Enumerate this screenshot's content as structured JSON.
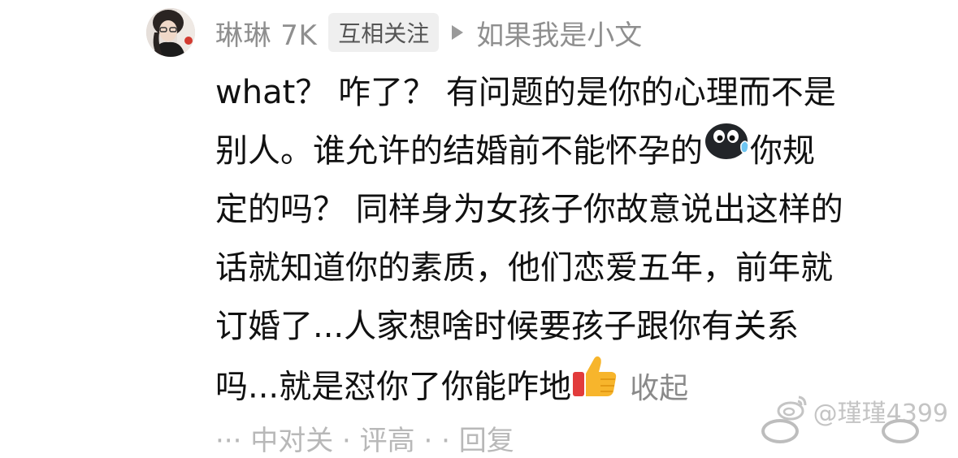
{
  "comment": {
    "author": {
      "name": "琳琳 7K",
      "relation_badge": "互相关注",
      "reply_to": "如果我是小文"
    },
    "body_lines": [
      "what？ 咋了？ 有问题的是你的心理而不是",
      "别人。谁允许的结婚前不能怀孕的",
      "你规",
      "定的吗？ 同样身为女孩子你故意说出这样的",
      "话就知道你的素质，他们恋爱五年，前年就",
      "订婚了...人家想啥时候要孩子跟你有关系",
      "吗...就是怼你了你能咋地"
    ],
    "emoji": {
      "sweat": "sweat-face-icon",
      "thumbs": "thumbs-up-icon"
    },
    "collapse_label": "收起",
    "footer_peek": "··· 中对关 · 评高 · · 回复",
    "watermark": "@瑾瑾4399"
  },
  "colors": {
    "meta_gray": "#8f8f8f",
    "text": "#111111",
    "badge_bg": "#efefef",
    "watermark": "#c4c4c4"
  }
}
